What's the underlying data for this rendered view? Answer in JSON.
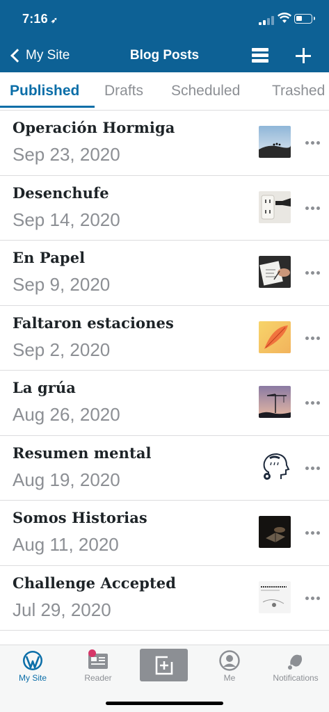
{
  "status_bar": {
    "time": "7:16",
    "location_arrow": "➶"
  },
  "nav": {
    "back_label": "My Site",
    "title": "Blog Posts"
  },
  "tabs": [
    "Published",
    "Drafts",
    "Scheduled",
    "Trashed"
  ],
  "posts": [
    {
      "title": "Operación Hormiga",
      "date": "Sep 23, 2020",
      "thumb": "ants-dusk"
    },
    {
      "title": "Desenchufe",
      "date": "Sep 14, 2020",
      "thumb": "wall-outlet"
    },
    {
      "title": "En Papel",
      "date": "Sep 9, 2020",
      "thumb": "hand-writing"
    },
    {
      "title": "Faltaron estaciones",
      "date": "Sep 2, 2020",
      "thumb": "autumn-leaf"
    },
    {
      "title": "La grúa",
      "date": "Aug 26, 2020",
      "thumb": "crane-sunset"
    },
    {
      "title": "Resumen mental",
      "date": "Aug 19, 2020",
      "thumb": "mind-head"
    },
    {
      "title": "Somos Historias",
      "date": "Aug 11, 2020",
      "thumb": "dark-book"
    },
    {
      "title": "Challenge Accepted",
      "date": "Jul 29, 2020",
      "thumb": "text-sketch"
    }
  ],
  "tabbar": [
    {
      "label": "My Site",
      "icon": "wordpress-icon"
    },
    {
      "label": "Reader",
      "icon": "reader-icon"
    },
    {
      "label": "",
      "icon": "new-post-icon"
    },
    {
      "label": "Me",
      "icon": "me-icon"
    },
    {
      "label": "Notifications",
      "icon": "bell-icon"
    }
  ],
  "colors": {
    "header": "#0d6195",
    "accent": "#0b6ea8",
    "badge": "#d63668"
  }
}
